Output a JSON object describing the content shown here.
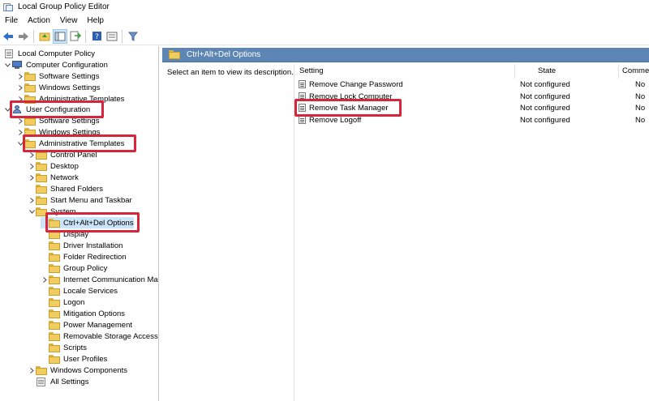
{
  "window": {
    "title": "Local Group Policy Editor"
  },
  "menu": [
    "File",
    "Action",
    "View",
    "Help"
  ],
  "toolbar": {
    "icons": [
      "back-arrow-icon",
      "forward-arrow-icon",
      "up-folder-icon",
      "show-hide-tree-icon",
      "export-list-icon",
      "help-icon",
      "properties-icon",
      "filter-icon"
    ]
  },
  "tree": {
    "root": "Local Computer Policy",
    "computer_config": "Computer Configuration",
    "cc_software": "Software Settings",
    "cc_windows": "Windows Settings",
    "cc_admin": "Administrative Templates",
    "user_config": "User Configuration",
    "uc_software": "Software Settings",
    "uc_windows": "Windows Settings",
    "uc_admin": "Administrative Templates",
    "control_panel": "Control Panel",
    "desktop": "Desktop",
    "network": "Network",
    "shared_folders": "Shared Folders",
    "start_menu": "Start Menu and Taskbar",
    "system": "System",
    "ctrl_alt_del": "Ctrl+Alt+Del Options",
    "display": "Display",
    "driver_install": "Driver Installation",
    "folder_redirect": "Folder Redirection",
    "group_policy": "Group Policy",
    "internet_comm": "Internet Communication Ma",
    "locale": "Locale Services",
    "logon": "Logon",
    "mitigation": "Mitigation Options",
    "power": "Power Management",
    "removable": "Removable Storage Access",
    "scripts": "Scripts",
    "user_profiles": "User Profiles",
    "windows_components": "Windows Components",
    "all_settings": "All Settings"
  },
  "pane": {
    "title": "Ctrl+Alt+Del Options",
    "description": "Select an item to view its description.",
    "columns": {
      "setting": "Setting",
      "state": "State",
      "comment": "Comme"
    },
    "rows": [
      {
        "setting": "Remove Change Password",
        "state": "Not configured",
        "comment": "No"
      },
      {
        "setting": "Remove Lock Computer",
        "state": "Not configured",
        "comment": "No"
      },
      {
        "setting": "Remove Task Manager",
        "state": "Not configured",
        "comment": "No"
      },
      {
        "setting": "Remove Logoff",
        "state": "Not configured",
        "comment": "No"
      }
    ]
  },
  "colors": {
    "highlight": "#d5263c",
    "pane_header": "#5e86b4",
    "folder": "#f1cd5f"
  }
}
